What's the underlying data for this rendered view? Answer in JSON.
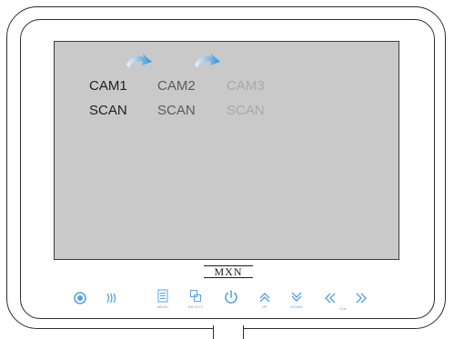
{
  "screen": {
    "cameras": [
      {
        "label": "CAM1",
        "scan": "SCAN",
        "state": "active"
      },
      {
        "label": "CAM2",
        "scan": "SCAN",
        "state": "normal"
      },
      {
        "label": "CAM3",
        "scan": "SCAN",
        "state": "dimmed"
      }
    ]
  },
  "brand": {
    "logo_text": "MXN"
  },
  "buttons": [
    {
      "icon": "target-icon",
      "label": ""
    },
    {
      "icon": "signal-waves-icon",
      "label": ""
    },
    {
      "icon": "menu-icon",
      "label": "MENU"
    },
    {
      "icon": "select-icon",
      "label": "SELECT"
    },
    {
      "icon": "power-icon",
      "label": ""
    },
    {
      "icon": "up-icon",
      "label": "UP"
    },
    {
      "icon": "down-icon",
      "label": "DOWN"
    },
    {
      "icon": "vol-down-icon",
      "label": ""
    },
    {
      "icon": "vol-label",
      "label": "VOL"
    },
    {
      "icon": "vol-up-icon",
      "label": ""
    }
  ],
  "colors": {
    "screen": "#c9c9c9",
    "button_accent": "#5aa0e0",
    "arrow_gradient_start": "#e8f4fc",
    "arrow_gradient_end": "#2f8fd6"
  }
}
